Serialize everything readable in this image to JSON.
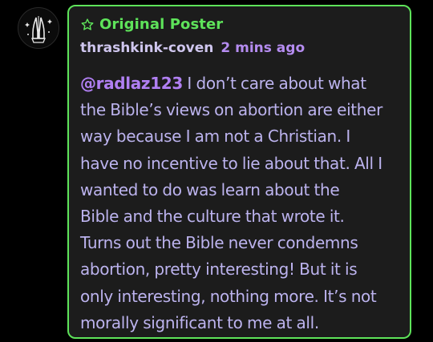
{
  "post": {
    "op_badge": "Original Poster",
    "author": "thrashkink-coven",
    "timestamp": "2 mins ago",
    "mention": "@radlaz123",
    "body_lines": [
      " I don’t care about what",
      "the Bible’s views on abortion are either",
      "way because I am not a Christian. I",
      "have no incentive to lie about that. All I",
      "wanted to do was learn about the",
      "Bible and the culture that wrote it.",
      "Turns out the Bible never condemns",
      "abortion, pretty interesting! But it is",
      "only interesting, nothing more. It’s not",
      "morally significant to me at all."
    ]
  },
  "icons": {
    "avatar": "praying-hands-avatar",
    "badge": "star-outline-icon"
  },
  "colors": {
    "background": "#000000",
    "card": "#1c1c1c",
    "op_accent": "#5ee35a",
    "mention": "#b07ff2",
    "text": "#bcb3ee"
  }
}
